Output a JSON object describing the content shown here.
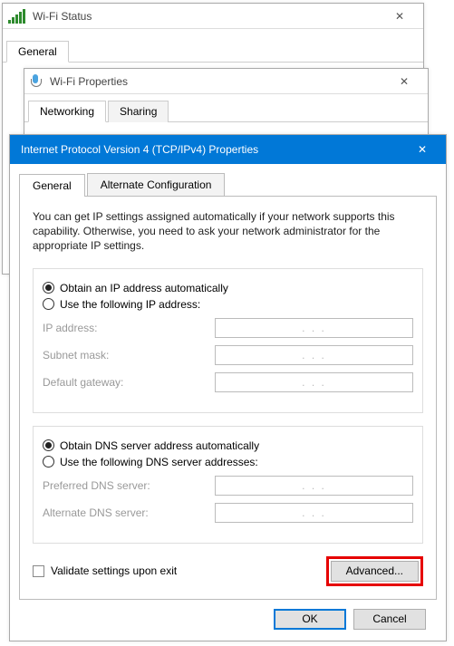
{
  "w1": {
    "title": "Wi-Fi Status",
    "tab_general": "General"
  },
  "w2": {
    "title": "Wi-Fi Properties",
    "tab_networking": "Networking",
    "tab_sharing": "Sharing"
  },
  "w3": {
    "title": "Internet Protocol Version 4 (TCP/IPv4) Properties",
    "tab_general": "General",
    "tab_alt": "Alternate Configuration",
    "intro": "You can get IP settings assigned automatically if your network supports this capability. Otherwise, you need to ask your network administrator for the appropriate IP settings.",
    "ip": {
      "auto": "Obtain an IP address automatically",
      "manual": "Use the following IP address:",
      "addr": "IP address:",
      "mask": "Subnet mask:",
      "gw": "Default gateway:"
    },
    "dns": {
      "auto": "Obtain DNS server address automatically",
      "manual": "Use the following DNS server addresses:",
      "pref": "Preferred DNS server:",
      "alt": "Alternate DNS server:"
    },
    "dots": ".       .       .",
    "validate": "Validate settings upon exit",
    "advanced": "Advanced...",
    "ok": "OK",
    "cancel": "Cancel"
  }
}
